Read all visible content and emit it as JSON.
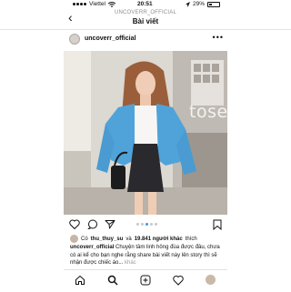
{
  "status": {
    "carrier": "Viettel",
    "time": "20:51",
    "battery": "29%"
  },
  "nav": {
    "account": "UNCOVERR_OFFICIAL",
    "title": "Bài viết",
    "back_glyph": "‹"
  },
  "post": {
    "username": "uncoverr_official",
    "more_glyph": "•••",
    "overlay_text": "tose",
    "likes_prefix": "Có",
    "likes_user": "thu_thuy_su",
    "likes_and": "và",
    "likes_count": "19.841 người khác",
    "likes_suffix": "thích",
    "caption_user": "uncoverr_official",
    "caption_text": "Chuyện tâm linh hông đùa được đâu, chưa có ai kể cho bạn nghe rằng share bài viết này lên story thì sẽ nhận được chiếc áo...",
    "caption_more": "khác"
  },
  "icons": {
    "like": "heart-icon",
    "comment": "comment-icon",
    "share": "share-icon",
    "save": "bookmark-icon",
    "home": "home-icon",
    "search": "search-icon",
    "add": "add-post-icon",
    "activity": "heart-icon",
    "profile": "profile-icon"
  },
  "colors": {
    "accent": "#3897f0",
    "cardigan": "#4fa3d9"
  },
  "carousel": {
    "pages": 5,
    "active": 3
  }
}
